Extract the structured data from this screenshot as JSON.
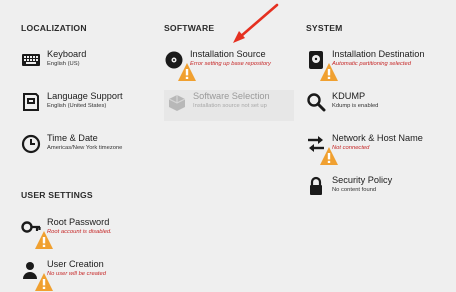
{
  "sections": {
    "localization": "LOCALIZATION",
    "software": "SOFTWARE",
    "system": "SYSTEM",
    "user_settings": "USER SETTINGS"
  },
  "spokes": {
    "keyboard": {
      "name": "Keyboard",
      "status": "English (US)",
      "icon": "keyboard-icon"
    },
    "language": {
      "name": "Language Support",
      "status": "English (United States)",
      "icon": "language-icon"
    },
    "time_date": {
      "name": "Time & Date",
      "status": "Americas/New York timezone",
      "icon": "clock-icon"
    },
    "installation_source": {
      "name": "Installation Source",
      "status": "Error setting up base repository",
      "icon": "disc-icon"
    },
    "software_selection": {
      "name": "Software Selection",
      "status": "Installation source not set up",
      "icon": "package-icon"
    },
    "installation_destination": {
      "name": "Installation Destination",
      "status": "Automatic partitioning selected",
      "icon": "harddisk-icon"
    },
    "kdump": {
      "name": "KDUMP",
      "status": "Kdump is enabled",
      "icon": "search-icon"
    },
    "network": {
      "name": "Network & Host Name",
      "status": "Not connected",
      "icon": "network-arrows-icon"
    },
    "security": {
      "name": "Security Policy",
      "status": "No content found",
      "icon": "lock-icon"
    },
    "root_password": {
      "name": "Root Password",
      "status": "Root account is disabled.",
      "icon": "key-icon"
    },
    "user_creation": {
      "name": "User Creation",
      "status": "No user will be created",
      "icon": "user-icon"
    }
  },
  "colors": {
    "background": "#efefef",
    "error_text": "#c62828",
    "warning_badge": "#f0a030",
    "annotation_arrow": "#e53020"
  }
}
